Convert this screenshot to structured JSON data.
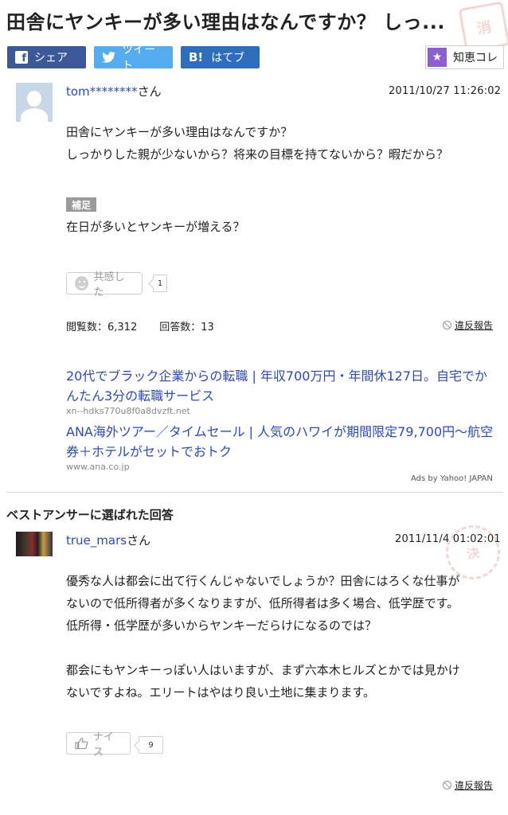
{
  "page": {
    "title": "田舎にヤンキーが多い理由はなんですか？ しっ...",
    "stamp_top": "消",
    "stamp_bottom": "決"
  },
  "share": {
    "facebook_label": "シェア",
    "twitter_label": "ツイート",
    "hatena_label": "はてブ",
    "hatena_icon_text": "B!",
    "chie_label": "知恵コレ"
  },
  "question": {
    "user": "tom********",
    "user_suffix": "さん",
    "date": "2011/10/27  11:26:02",
    "lines": [
      "田舎にヤンキーが多い理由はなんですか？",
      "しっかりした親が少ないから？将来の目標を持てないから？暇だから？"
    ],
    "supplement_label": "補足",
    "supplement_text": "在日が多いとヤンキーが増える？",
    "empathy_label": "共感した",
    "empathy_count": "1",
    "views_label": "閲覧数：6,312",
    "answers_label": "回答数：13",
    "report_label": "違反報告"
  },
  "ads": {
    "items": [
      {
        "title": "20代でブラック企業からの転職 | 年収700万円・年間休127日。自宅でかんたん3分の転職サービス",
        "url": "xn--hdks770u8f0a8dvzft.net"
      },
      {
        "title": "ANA海外ツアー／タイムセール | 人気のハワイが期間限定79,700円〜航空券＋ホテルがセットでおトク",
        "url": "www.ana.co.jp"
      }
    ],
    "ads_by": "Ads by Yahoo! JAPAN"
  },
  "best_answer": {
    "section_title": "ベストアンサーに選ばれた回答",
    "user": "true_mars",
    "user_suffix": "さん",
    "date": "2011/11/4  01:02:01",
    "paragraph1": [
      "優秀な人は都会に出て行くんじゃないでしょうか？田舎にはろくな仕事が",
      "ないので低所得者が多くなりますが、低所得者は多く場合、低学歴です。",
      "低所得・低学歴が多いからヤンキーだらけになるのでは？"
    ],
    "paragraph2": [
      "都会にもヤンキーっぽい人はいますが、まず六本木ヒルズとかでは見かけ",
      "ないですよね。エリートはやはり良い土地に集まります。"
    ],
    "nice_label": "ナイス",
    "nice_count": "9",
    "report_label": "違反報告"
  },
  "colors": {
    "facebook": "#3b5998",
    "twitter": "#55acee",
    "hatena": "#2c6ebd",
    "chie_star": "#8c5dd4",
    "link": "#2a49c5"
  }
}
